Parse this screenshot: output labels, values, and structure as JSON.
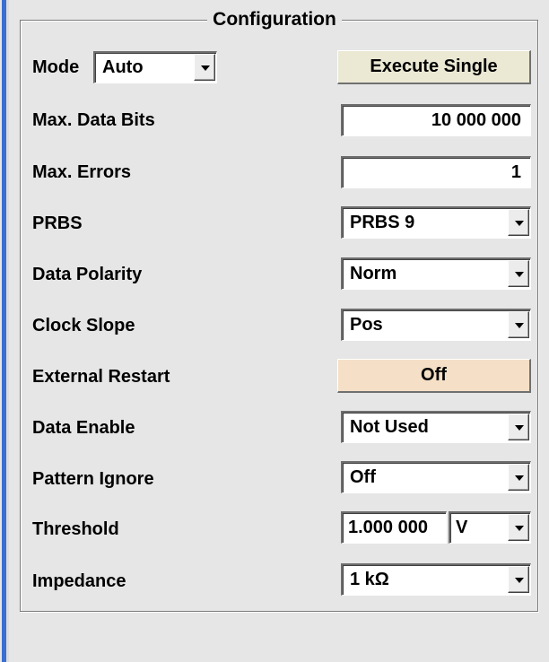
{
  "panel": {
    "title": "Configuration"
  },
  "mode": {
    "label": "Mode",
    "value": "Auto"
  },
  "execute_single": {
    "label": "Execute Single"
  },
  "max_data_bits": {
    "label": "Max. Data Bits",
    "value": "10 000 000"
  },
  "max_errors": {
    "label": "Max. Errors",
    "value": "1"
  },
  "prbs": {
    "label": "PRBS",
    "value": "PRBS 9"
  },
  "data_polarity": {
    "label": "Data Polarity",
    "value": "Norm"
  },
  "clock_slope": {
    "label": "Clock Slope",
    "value": "Pos"
  },
  "external_restart": {
    "label": "External Restart",
    "value": "Off"
  },
  "data_enable": {
    "label": "Data Enable",
    "value": "Not Used"
  },
  "pattern_ignore": {
    "label": "Pattern Ignore",
    "value": "Off"
  },
  "threshold": {
    "label": "Threshold",
    "value": "1.000 000",
    "unit": "V"
  },
  "impedance": {
    "label": "Impedance",
    "value": "1 kΩ"
  },
  "colors": {
    "accent": "#3a6fd0",
    "background": "#e6e6e6",
    "execute_button": "#ebe8d4",
    "toggle_off_button": "#f5dfc6"
  }
}
